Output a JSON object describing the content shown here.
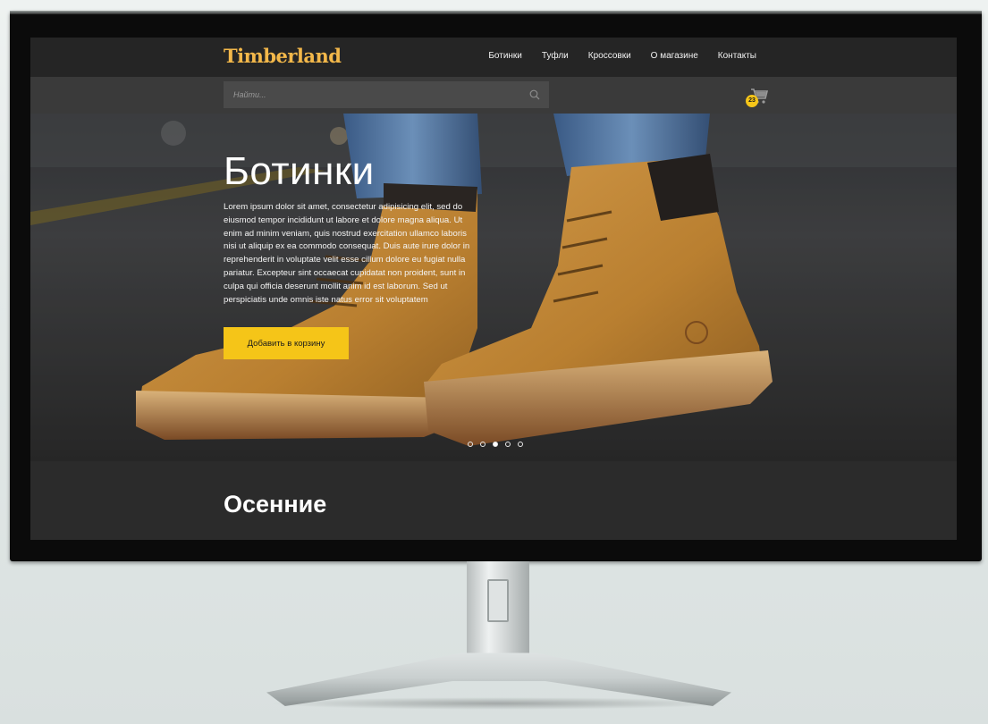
{
  "header": {
    "logo": "Timberland",
    "nav": [
      "Ботинки",
      "Туфли",
      "Кроссовки",
      "О магазине",
      "Контакты"
    ]
  },
  "search": {
    "placeholder": "Найти..."
  },
  "cart": {
    "count": "23",
    "badge_color": "#f5c518"
  },
  "hero": {
    "title": "Ботинки",
    "text": "Lorem ipsum dolor sit amet, consectetur adipisicing elit, sed do eiusmod tempor incididunt ut labore et dolore magna aliqua. Ut enim ad minim veniam, quis nostrud exercitation ullamco laboris nisi ut aliquip ex ea commodo consequat. Duis aute irure dolor in reprehenderit in voluptate velit esse cillum dolore eu fugiat nulla pariatur. Excepteur sint occaecat cupidatat non proident, sunt in culpa qui officia deserunt mollit anim id est laborum. Sed ut perspiciatis unde omnis iste natus error sit voluptatem",
    "cta_label": "Добавить в корзину",
    "slides_total": 5,
    "slide_active": 3
  },
  "section": {
    "title": "Осенние"
  },
  "colors": {
    "accent": "#f5c518",
    "logo": "#f3b84a",
    "header_bg": "#252525"
  }
}
